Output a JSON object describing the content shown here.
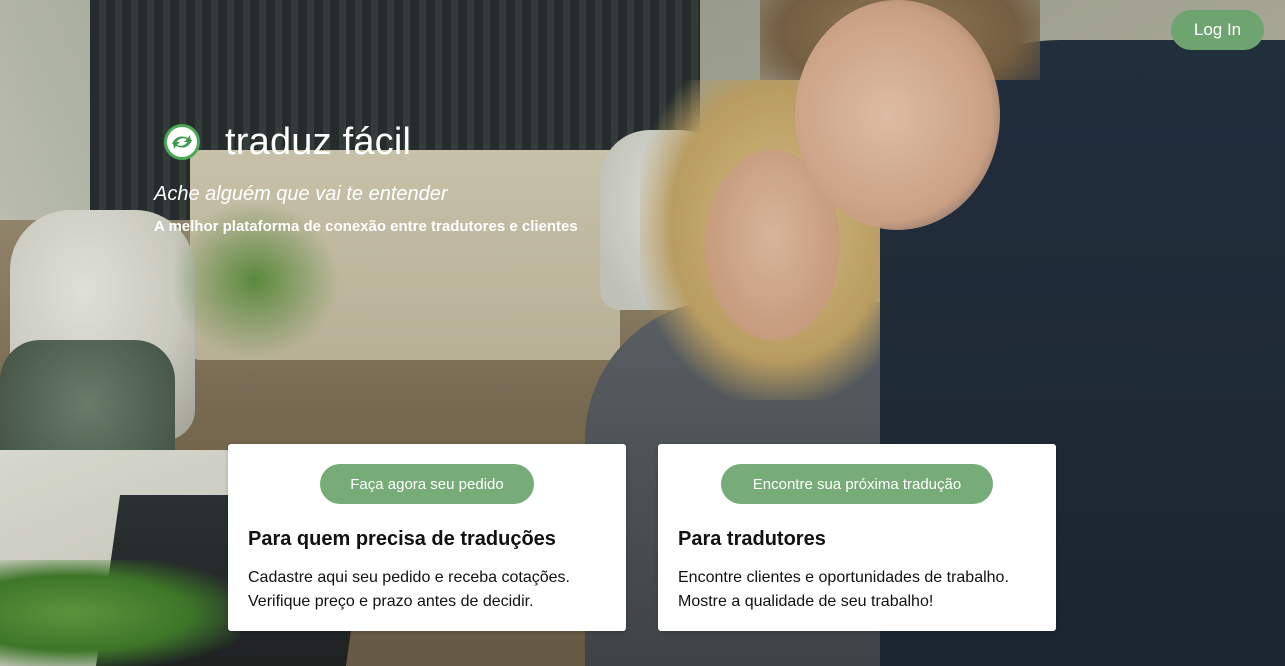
{
  "header": {
    "login_label": "Log In"
  },
  "brand": {
    "logo_icon": "traduz-facil-logo-icon",
    "name": "traduz fácil",
    "tagline": "Ache alguém que vai te entender",
    "subtagline": "A melhor plataforma de conexão entre tradutores e clientes"
  },
  "cards": [
    {
      "button_label": "Faça agora seu pedido",
      "title": "Para quem precisa de traduções",
      "line1": "Cadastre aqui seu pedido e receba cotações.",
      "line2": "Verifique preço e prazo antes de decidir."
    },
    {
      "button_label": "Encontre sua próxima tradução",
      "title": "Para tradutores",
      "line1": "Encontre clientes e oportunidades de trabalho.",
      "line2": "Mostre a qualidade de seu trabalho!"
    }
  ],
  "colors": {
    "accent_green": "#6ea46f",
    "logo_green": "#49a855",
    "card_bg": "#ffffff",
    "text_dark": "#111111"
  }
}
